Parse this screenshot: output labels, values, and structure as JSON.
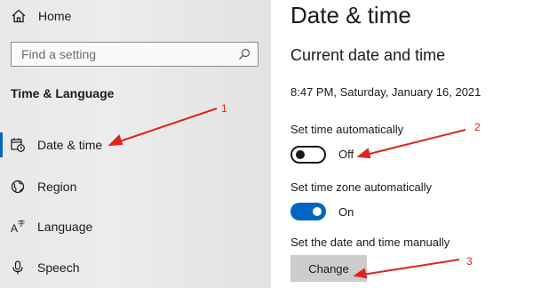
{
  "sidebar": {
    "home_label": "Home",
    "search_placeholder": "Find a setting",
    "section_title": "Time & Language",
    "items": [
      {
        "label": "Date & time",
        "icon": "date-time-icon",
        "selected": true
      },
      {
        "label": "Region",
        "icon": "region-icon"
      },
      {
        "label": "Language",
        "icon": "language-icon"
      },
      {
        "label": "Speech",
        "icon": "microphone-icon"
      }
    ]
  },
  "main": {
    "title": "Date & time",
    "subtitle": "Current date and time",
    "current_datetime": "8:47 PM, Saturday, January 16, 2021",
    "set_time_auto": {
      "label": "Set time automatically",
      "state": "Off"
    },
    "set_timezone_auto": {
      "label": "Set time zone automatically",
      "state": "On"
    },
    "set_manual": {
      "label": "Set the date and time manually",
      "button_label": "Change"
    }
  },
  "annotations": {
    "markers": [
      "1",
      "2",
      "3"
    ],
    "arrow_color": "#e0221c"
  },
  "colors": {
    "accent": "#0067c0",
    "sidebar_bg": "#e8e8e8",
    "button_bg": "#cccccc"
  }
}
